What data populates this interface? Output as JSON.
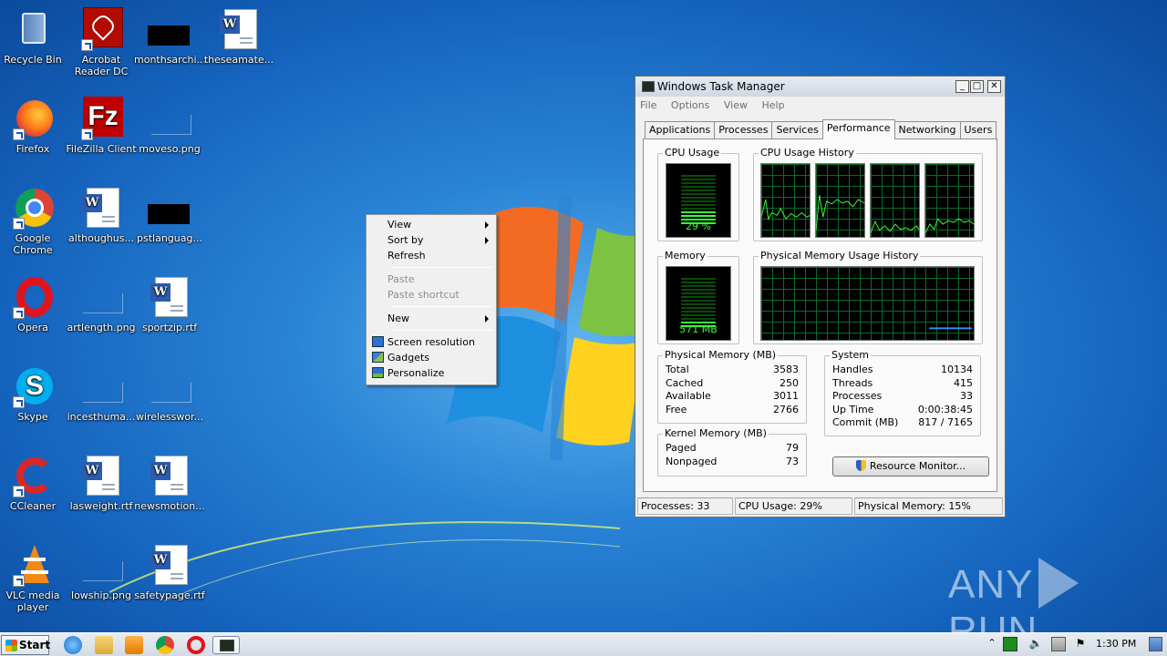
{
  "desktop_icons": [
    {
      "label": "Recycle Bin",
      "icon": "recycle-bin-icon"
    },
    {
      "label": "Acrobat Reader DC",
      "icon": "acrobat-icon"
    },
    {
      "label": "monthsarchi...",
      "icon": "image-file-icon"
    },
    {
      "label": "theseamate...",
      "icon": "word-doc-icon"
    },
    {
      "label": "Firefox",
      "icon": "firefox-icon"
    },
    {
      "label": "FileZilla Client",
      "icon": "filezilla-icon"
    },
    {
      "label": "moveso.png",
      "icon": "image-file-icon"
    },
    {
      "label": "Google Chrome",
      "icon": "chrome-icon"
    },
    {
      "label": "althoughus...",
      "icon": "word-doc-icon"
    },
    {
      "label": "pstlanguag...",
      "icon": "image-file-icon"
    },
    {
      "label": "Opera",
      "icon": "opera-icon"
    },
    {
      "label": "artlength.png",
      "icon": "image-file-icon"
    },
    {
      "label": "sportzip.rtf",
      "icon": "word-doc-icon"
    },
    {
      "label": "Skype",
      "icon": "skype-icon"
    },
    {
      "label": "incesthuma...",
      "icon": "image-file-icon"
    },
    {
      "label": "wirelesswor...",
      "icon": "image-file-icon"
    },
    {
      "label": "CCleaner",
      "icon": "ccleaner-icon"
    },
    {
      "label": "lasweight.rtf",
      "icon": "word-doc-icon"
    },
    {
      "label": "newsmotion...",
      "icon": "word-doc-icon"
    },
    {
      "label": "VLC media player",
      "icon": "vlc-icon"
    },
    {
      "label": "lowship.png",
      "icon": "image-file-icon"
    },
    {
      "label": "safetypage.rtf",
      "icon": "word-doc-icon"
    }
  ],
  "context_menu": {
    "view": "View",
    "sort_by": "Sort by",
    "refresh": "Refresh",
    "paste": "Paste",
    "paste_shortcut": "Paste shortcut",
    "new": "New",
    "screen_resolution": "Screen resolution",
    "gadgets": "Gadgets",
    "personalize": "Personalize"
  },
  "task_manager": {
    "title": "Windows Task Manager",
    "menu": [
      "File",
      "Options",
      "View",
      "Help"
    ],
    "tabs": [
      "Applications",
      "Processes",
      "Services",
      "Performance",
      "Networking",
      "Users"
    ],
    "active_tab": "Performance",
    "cpu_usage": {
      "label": "CPU Usage",
      "value": "29 %",
      "level": 0.29
    },
    "cpu_history_label": "CPU Usage History",
    "memory": {
      "label": "Memory",
      "value": "571 MB",
      "level": 0.15
    },
    "phys_history_label": "Physical Memory Usage History",
    "physical_memory": {
      "label": "Physical Memory (MB)",
      "rows": [
        [
          "Total",
          "3583"
        ],
        [
          "Cached",
          "250"
        ],
        [
          "Available",
          "3011"
        ],
        [
          "Free",
          "2766"
        ]
      ]
    },
    "kernel_memory": {
      "label": "Kernel Memory (MB)",
      "rows": [
        [
          "Paged",
          "79"
        ],
        [
          "Nonpaged",
          "73"
        ]
      ]
    },
    "system": {
      "label": "System",
      "rows": [
        [
          "Handles",
          "10134"
        ],
        [
          "Threads",
          "415"
        ],
        [
          "Processes",
          "33"
        ],
        [
          "Up Time",
          "0:00:38:45"
        ],
        [
          "Commit (MB)",
          "817 / 7165"
        ]
      ]
    },
    "resource_monitor_button": "Resource Monitor...",
    "status": {
      "processes": "Processes: 33",
      "cpu": "CPU Usage: 29%",
      "memory": "Physical Memory: 15%"
    }
  },
  "taskbar": {
    "start": "Start",
    "pinned": [
      "ie-icon",
      "explorer-icon",
      "media-player-icon",
      "chrome-icon",
      "opera-icon",
      "task-manager-icon"
    ],
    "clock": "1:30 PM"
  },
  "watermark": {
    "left": "ANY",
    "right": "RUN"
  }
}
